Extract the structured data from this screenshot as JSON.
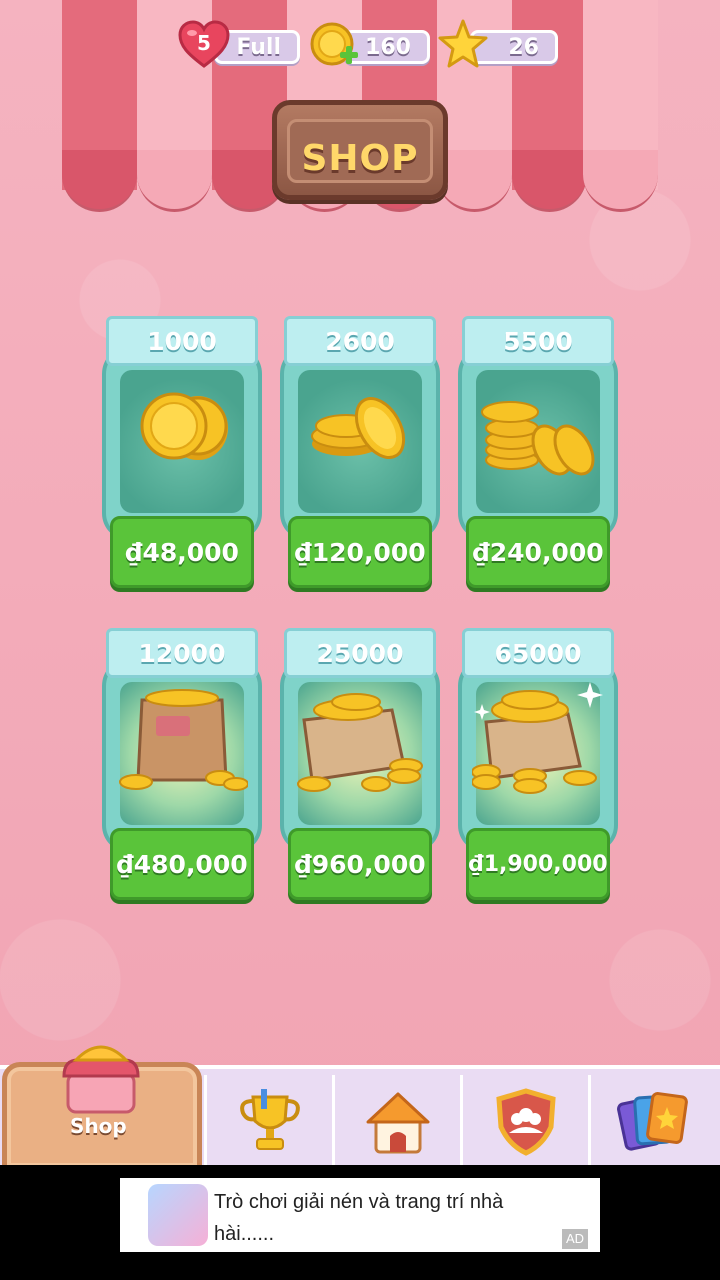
{
  "status": {
    "lives": "5",
    "lives_label": "Full",
    "coins": "160",
    "stars": "26"
  },
  "sign": {
    "title": "SHOP"
  },
  "packs": [
    {
      "amount": "1000",
      "price": "₫48,000"
    },
    {
      "amount": "2600",
      "price": "₫120,000"
    },
    {
      "amount": "5500",
      "price": "₫240,000"
    },
    {
      "amount": "12000",
      "price": "₫480,000"
    },
    {
      "amount": "25000",
      "price": "₫960,000"
    },
    {
      "amount": "65000",
      "price": "₫1,900,000"
    }
  ],
  "tabs": [
    {
      "label": "Shop",
      "icon": "shop-icon"
    },
    {
      "label": "",
      "icon": "trophy-icon"
    },
    {
      "label": "",
      "icon": "house-icon"
    },
    {
      "label": "",
      "icon": "team-shield-icon"
    },
    {
      "label": "",
      "icon": "cards-icon"
    }
  ],
  "ad": {
    "text": "Trò chơi giải nén và trang trí nhà hài......",
    "badge": "AD"
  },
  "colors": {
    "background": "#f3aab8",
    "awning_red": "#e46b7c",
    "awning_pink": "#f8b7c2",
    "price_green": "#5ac43a",
    "jar_teal": "#7fd3c9"
  }
}
